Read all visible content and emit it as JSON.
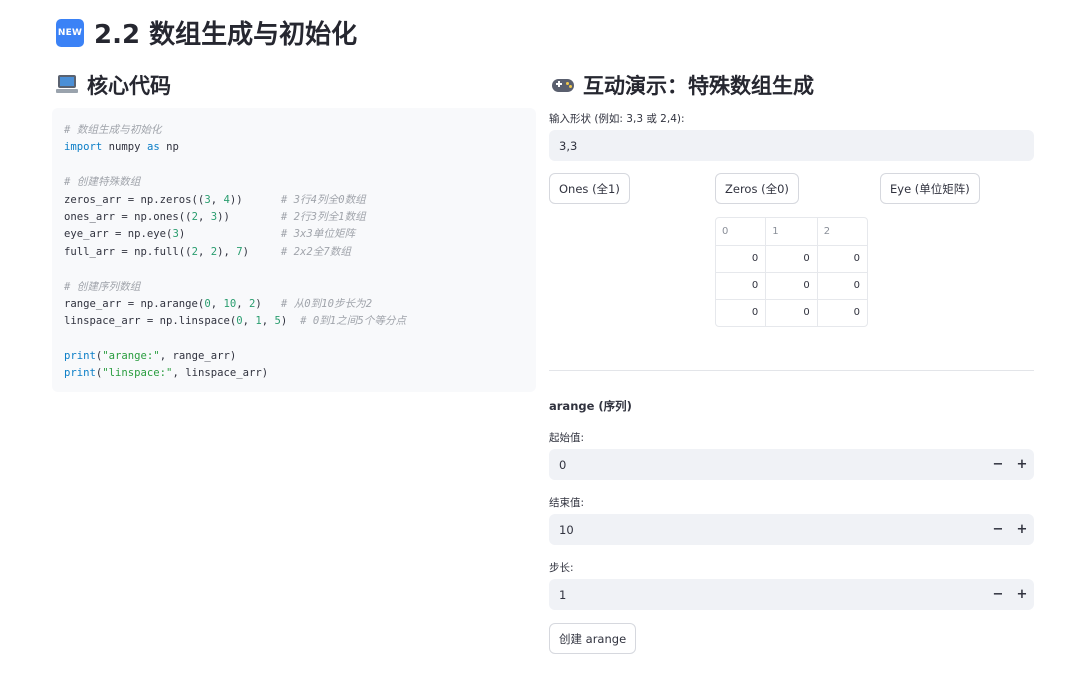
{
  "header": {
    "badge": "NEW",
    "title": "2.2 数组生成与初始化"
  },
  "left": {
    "section_title": "核心代码",
    "code": [
      [
        {
          "t": "comment",
          "s": "# 数组生成与初始化"
        }
      ],
      [
        {
          "t": "keyword",
          "s": "import"
        },
        {
          "t": "plain",
          "s": " numpy "
        },
        {
          "t": "keyword",
          "s": "as"
        },
        {
          "t": "plain",
          "s": " np"
        }
      ],
      [],
      [
        {
          "t": "comment",
          "s": "# 创建特殊数组"
        }
      ],
      [
        {
          "t": "plain",
          "s": "zeros_arr = np.zeros(("
        },
        {
          "t": "num",
          "s": "3"
        },
        {
          "t": "plain",
          "s": ", "
        },
        {
          "t": "num",
          "s": "4"
        },
        {
          "t": "plain",
          "s": "))      "
        },
        {
          "t": "comment",
          "s": "# 3行4列全0数组"
        }
      ],
      [
        {
          "t": "plain",
          "s": "ones_arr = np.ones(("
        },
        {
          "t": "num",
          "s": "2"
        },
        {
          "t": "plain",
          "s": ", "
        },
        {
          "t": "num",
          "s": "3"
        },
        {
          "t": "plain",
          "s": "))        "
        },
        {
          "t": "comment",
          "s": "# 2行3列全1数组"
        }
      ],
      [
        {
          "t": "plain",
          "s": "eye_arr = np.eye("
        },
        {
          "t": "num",
          "s": "3"
        },
        {
          "t": "plain",
          "s": ")               "
        },
        {
          "t": "comment",
          "s": "# 3x3单位矩阵"
        }
      ],
      [
        {
          "t": "plain",
          "s": "full_arr = np.full(("
        },
        {
          "t": "num",
          "s": "2"
        },
        {
          "t": "plain",
          "s": ", "
        },
        {
          "t": "num",
          "s": "2"
        },
        {
          "t": "plain",
          "s": "), "
        },
        {
          "t": "num",
          "s": "7"
        },
        {
          "t": "plain",
          "s": ")     "
        },
        {
          "t": "comment",
          "s": "# 2x2全7数组"
        }
      ],
      [],
      [
        {
          "t": "comment",
          "s": "# 创建序列数组"
        }
      ],
      [
        {
          "t": "plain",
          "s": "range_arr = np.arange("
        },
        {
          "t": "num",
          "s": "0"
        },
        {
          "t": "plain",
          "s": ", "
        },
        {
          "t": "num",
          "s": "10"
        },
        {
          "t": "plain",
          "s": ", "
        },
        {
          "t": "num",
          "s": "2"
        },
        {
          "t": "plain",
          "s": ")   "
        },
        {
          "t": "comment",
          "s": "# 从0到10步长为2"
        }
      ],
      [
        {
          "t": "plain",
          "s": "linspace_arr = np.linspace("
        },
        {
          "t": "num",
          "s": "0"
        },
        {
          "t": "plain",
          "s": ", "
        },
        {
          "t": "num",
          "s": "1"
        },
        {
          "t": "plain",
          "s": ", "
        },
        {
          "t": "num",
          "s": "5"
        },
        {
          "t": "plain",
          "s": ")  "
        },
        {
          "t": "comment",
          "s": "# 0到1之间5个等分点"
        }
      ],
      [],
      [
        {
          "t": "keyword",
          "s": "print"
        },
        {
          "t": "plain",
          "s": "("
        },
        {
          "t": "string",
          "s": "\"arange:\""
        },
        {
          "t": "plain",
          "s": ", range_arr)"
        }
      ],
      [
        {
          "t": "keyword",
          "s": "print"
        },
        {
          "t": "plain",
          "s": "("
        },
        {
          "t": "string",
          "s": "\"linspace:\""
        },
        {
          "t": "plain",
          "s": ", linspace_arr)"
        }
      ]
    ]
  },
  "right": {
    "section_title": "互动演示：特殊数组生成",
    "shape_label": "输入形状 (例如: 3,3 或 2,4):",
    "shape_value": "3,3",
    "buttons": {
      "ones": "Ones (全1)",
      "zeros": "Zeros (全0)",
      "eye": "Eye (单位矩阵)"
    },
    "table": {
      "columns": [
        "0",
        "1",
        "2"
      ],
      "rows": [
        [
          "0",
          "0",
          "0"
        ],
        [
          "0",
          "0",
          "0"
        ],
        [
          "0",
          "0",
          "0"
        ]
      ]
    },
    "arange_heading": "arange (序列)",
    "start_label": "起始值:",
    "start_value": "0",
    "end_label": "结束值:",
    "end_value": "10",
    "step_label": "步长:",
    "step_value": "1",
    "stepper_minus": "−",
    "stepper_plus": "+",
    "create_button": "创建 arange"
  }
}
